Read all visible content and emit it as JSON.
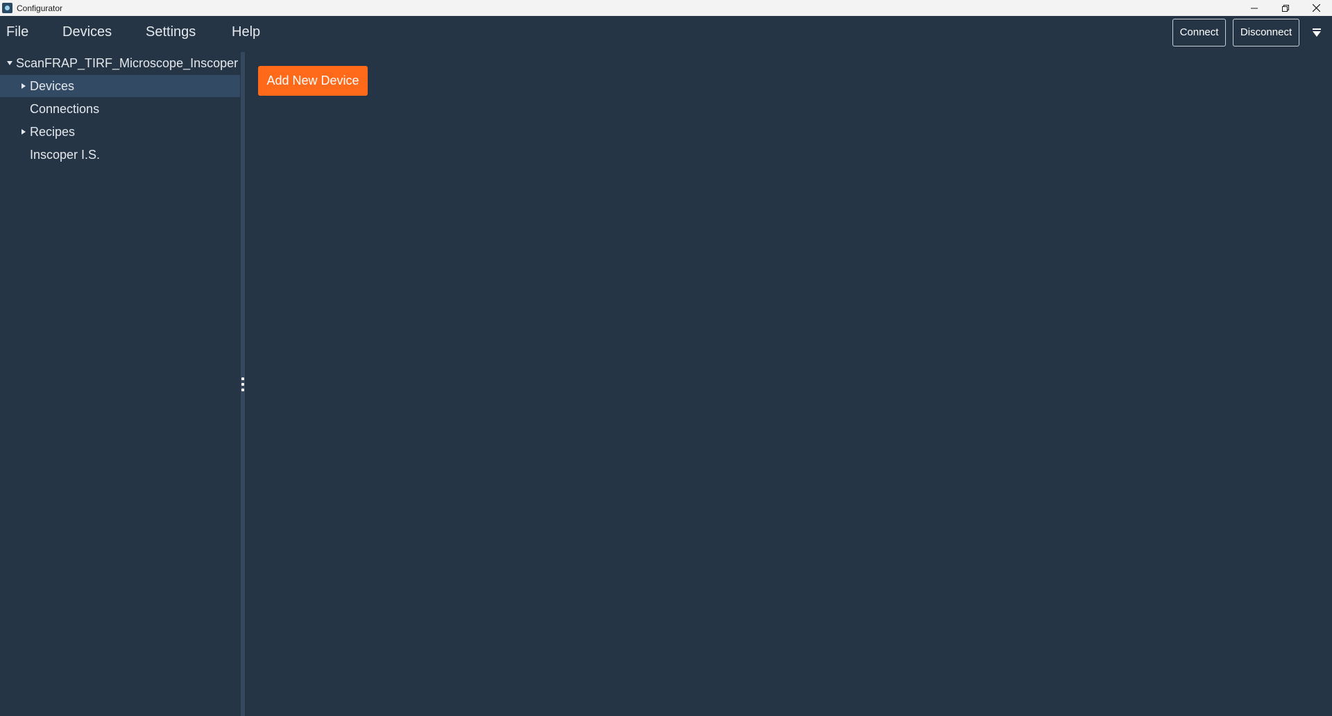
{
  "window": {
    "title": "Configurator",
    "controls": {
      "minimize_icon": "minimize-icon",
      "restore_icon": "restore-icon",
      "close_icon": "close-icon"
    }
  },
  "menu": {
    "file": "File",
    "devices": "Devices",
    "settings": "Settings",
    "help": "Help"
  },
  "toolbar": {
    "connect_label": "Connect",
    "disconnect_label": "Disconnect",
    "dropdown_icon": "triangle-down-icon"
  },
  "sidebar": {
    "root": {
      "label": "ScanFRAP_TIRF_Microscope_Inscoper",
      "expanded": true
    },
    "items": [
      {
        "label": "Devices",
        "has_children": true,
        "selected": true
      },
      {
        "label": "Connections",
        "has_children": false,
        "selected": false
      },
      {
        "label": "Recipes",
        "has_children": true,
        "selected": false
      },
      {
        "label": "Inscoper I.S.",
        "has_children": false,
        "selected": false
      }
    ]
  },
  "main": {
    "add_device_label": "Add New Device"
  },
  "colors": {
    "background": "#253546",
    "selected_row": "#324a63",
    "accent": "#ff6a1a",
    "text": "#e4e8ec"
  }
}
